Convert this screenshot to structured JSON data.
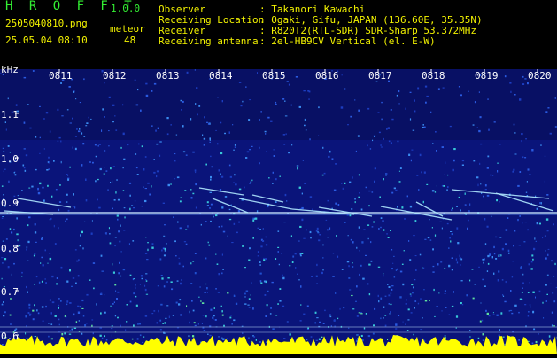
{
  "app": {
    "title": "H R O F F T",
    "version": "1.0.0"
  },
  "file": {
    "name": "2505040810.png",
    "datetime": "25.05.04 08:10"
  },
  "meteor": {
    "label": "meteor",
    "count": "48"
  },
  "info": [
    {
      "label": "Observer",
      "value": ": Takanori Kawachi"
    },
    {
      "label": "Receiving Location",
      "value": ": Ogaki, Gifu, JAPAN (136.60E, 35.35N)"
    },
    {
      "label": "Receiver",
      "value": ": R820T2(RTL-SDR) SDR-Sharp 53.372MHz"
    },
    {
      "label": "Receiving antenna",
      "value": ": 2el-HB9CV Vertical (el. E-W)"
    }
  ],
  "axis": {
    "y_unit": "kHz",
    "y_ticks": [
      "1.1",
      "1.0",
      "0.9",
      "0.8",
      "0.7",
      "0.6"
    ],
    "x_ticks": [
      "0811",
      "0812",
      "0813",
      "0814",
      "0815",
      "0816",
      "0817",
      "0818",
      "0819",
      "0820"
    ]
  },
  "colors": {
    "background": "#000000",
    "header_text_yellow": "#f2f200",
    "header_text_white": "#ffffff",
    "title_green": "#33ee33",
    "spectrum_base": "#0a147a",
    "carrier_line": "#c8e6ff",
    "noise_floor": "#ffff00"
  }
}
